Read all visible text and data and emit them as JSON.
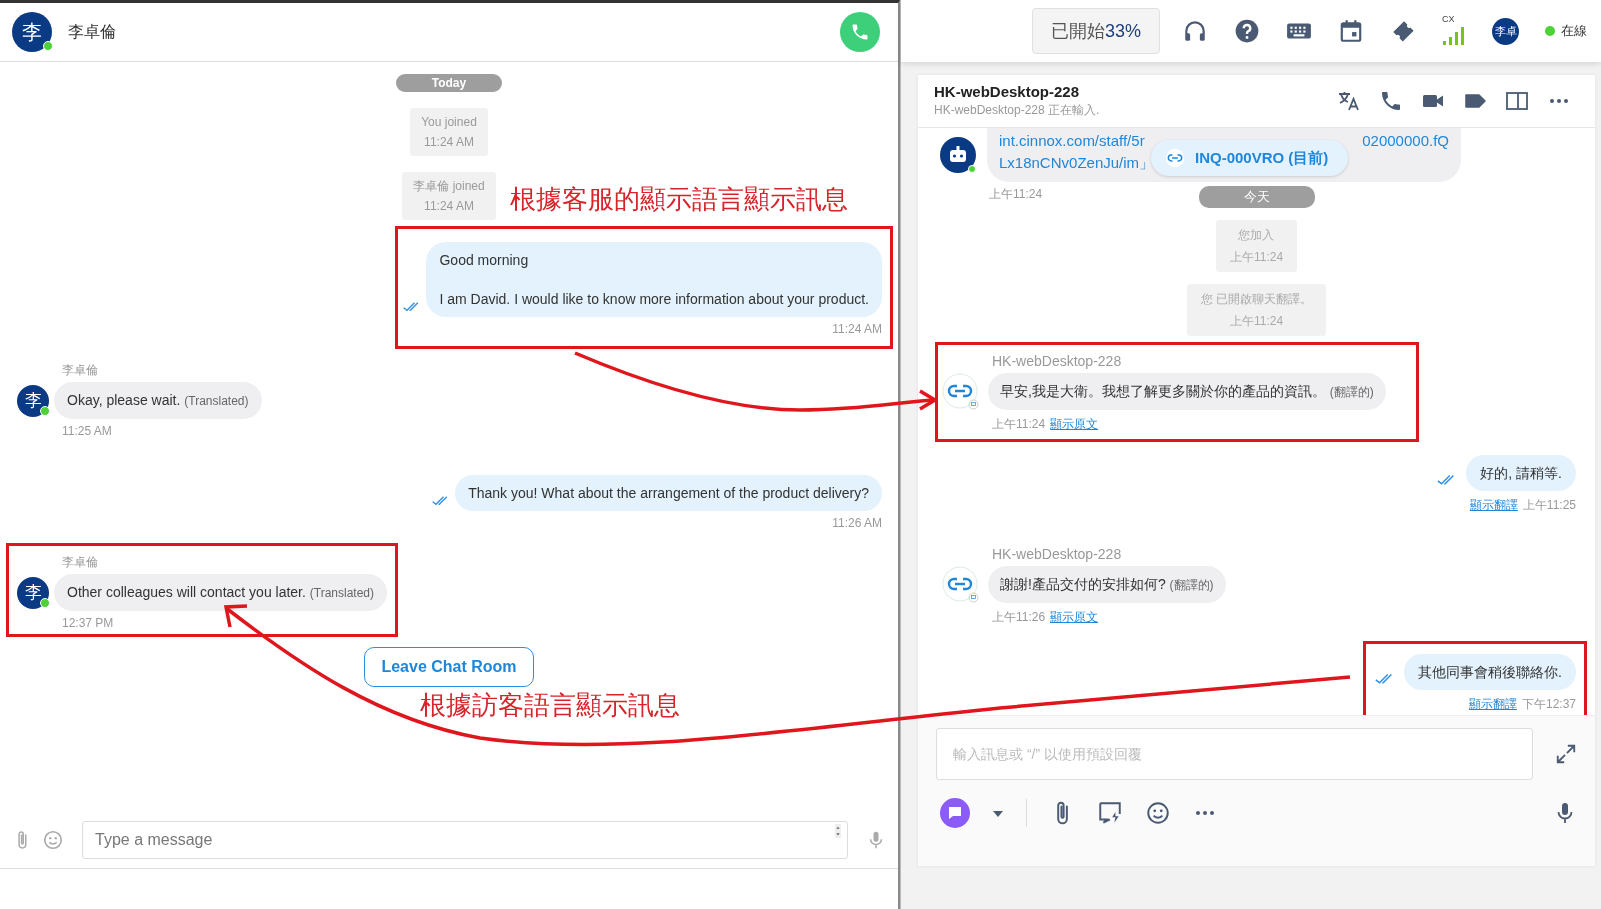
{
  "left_chat": {
    "contact": {
      "avatar": "李",
      "name": "李卓倫",
      "online": true
    },
    "feed": [
      {
        "kind": "date",
        "text": "Today"
      },
      {
        "kind": "event",
        "text": "You joined",
        "time": "11:24 AM"
      },
      {
        "kind": "event",
        "text": "李卓倫 joined",
        "time": "11:24 AM"
      },
      {
        "kind": "outgoing",
        "highlighted": true,
        "lines": [
          "Good morning",
          "I am David. I would like to know more information about your product."
        ],
        "time": "11:24 AM"
      },
      {
        "kind": "incoming",
        "highlighted": false,
        "sender": "李卓倫",
        "avatar": "李",
        "text": "Okay, please wait.",
        "tag": "(Translated)",
        "time": "11:25 AM"
      },
      {
        "kind": "outgoing",
        "highlighted": false,
        "lines": [
          "Thank you! What about the arrangement of the product delivery?"
        ],
        "time": "11:26 AM"
      },
      {
        "kind": "incoming",
        "highlighted": true,
        "sender": "李卓倫",
        "avatar": "李",
        "text": "Other colleagues will contact you later.",
        "tag": "(Translated)",
        "time": "12:37 PM"
      }
    ],
    "leave_button": "Leave Chat Room",
    "composer": {
      "placeholder": "Type a message"
    }
  },
  "agent_console": {
    "top_bar": {
      "progress": {
        "label": "已開始",
        "value": "33%"
      },
      "signal_label": "CX",
      "avatar": "李卓",
      "status": "在線"
    },
    "conversation": {
      "title": "HK-webDesktop-228",
      "subtitle": "HK-webDesktop-228 正在輸入.",
      "feed": [
        {
          "kind": "bot",
          "line_1_start": "int.cinnox.com/staff/5r",
          "line_1_end": "02000000.fQ",
          "line_2": "Lx18nCNv0ZenJu/im」",
          "chip": "INQ-000VRO (目前)",
          "time": "上午11:24"
        },
        {
          "kind": "date",
          "text": "今天"
        },
        {
          "kind": "event",
          "text": "您加入",
          "time": "上午11:24"
        },
        {
          "kind": "event",
          "text": "您 已開啟聊天翻譯。",
          "time": "上午11:24"
        },
        {
          "kind": "incoming",
          "highlighted": true,
          "sender": "HK-webDesktop-228",
          "text": "早安,我是大衛。我想了解更多關於你的產品的資訊。",
          "tag": "(翻譯的)",
          "time": "上午11:24",
          "link": "顯示原文"
        },
        {
          "kind": "outgoing",
          "highlighted": false,
          "text": "好的, 請稍等.",
          "link": "顯示翻譯",
          "time": "上午11:25"
        },
        {
          "kind": "incoming",
          "highlighted": false,
          "sender": "HK-webDesktop-228",
          "text": "謝謝!產品交付的安排如何?",
          "tag": "(翻譯的)",
          "time": "上午11:26",
          "link": "顯示原文"
        },
        {
          "kind": "outgoing",
          "highlighted": true,
          "text": "其他同事會稍後聯絡你.",
          "link": "顯示翻譯",
          "time": "下午12:37"
        }
      ],
      "composer": {
        "placeholder": "輸入訊息或 “/” 以使用預設回覆"
      }
    }
  },
  "annotations": [
    "根據客服的顯示語言顯示訊息",
    "根據訪客語言顯示訊息"
  ]
}
